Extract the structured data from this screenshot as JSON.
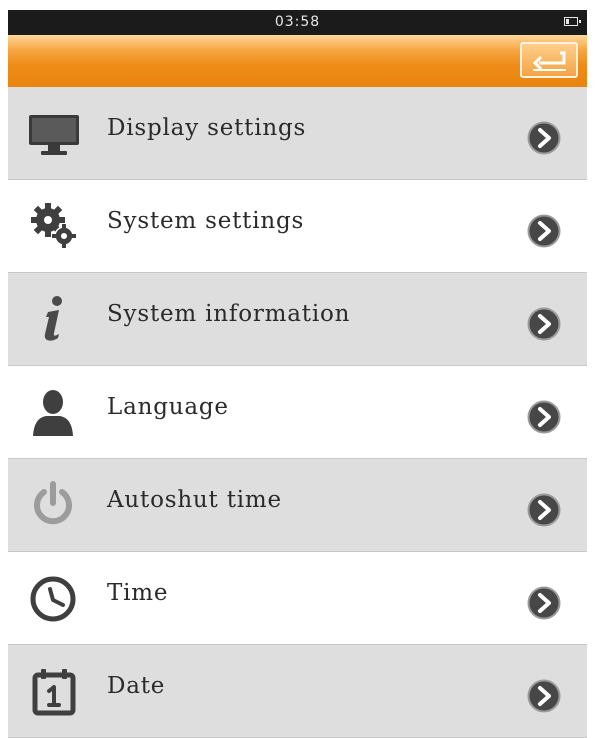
{
  "status_bar": {
    "time": "03:58",
    "battery_icon": "battery-icon"
  },
  "header": {
    "back_icon": "return-arrow-icon",
    "accent": "#ee8c18"
  },
  "menu": {
    "items": [
      {
        "label": "Display settings",
        "icon": "monitor-icon"
      },
      {
        "label": "System settings",
        "icon": "gears-icon"
      },
      {
        "label": "System information",
        "icon": "info-icon"
      },
      {
        "label": "Language",
        "icon": "person-icon"
      },
      {
        "label": "Autoshut time",
        "icon": "power-icon"
      },
      {
        "label": "Time",
        "icon": "clock-icon"
      },
      {
        "label": "Date",
        "icon": "calendar-icon"
      }
    ],
    "arrow_icon": "chevron-right-icon"
  }
}
